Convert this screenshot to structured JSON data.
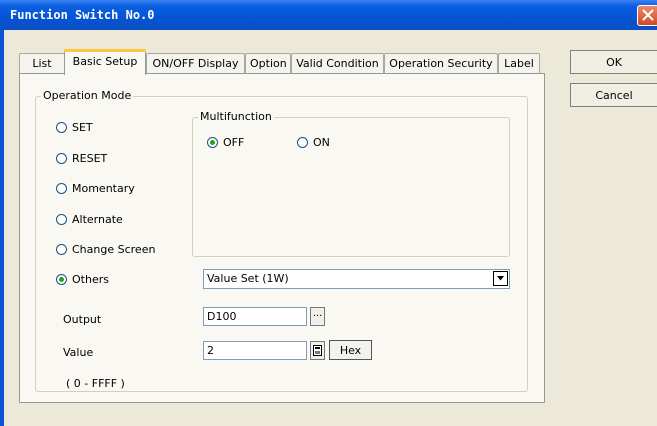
{
  "window": {
    "title": "Function Switch No.0"
  },
  "tabs": [
    {
      "label": "List"
    },
    {
      "label": "Basic Setup"
    },
    {
      "label": "ON/OFF Display"
    },
    {
      "label": "Option"
    },
    {
      "label": "Valid Condition"
    },
    {
      "label": "Operation Security"
    },
    {
      "label": "Label"
    }
  ],
  "active_tab": "Basic Setup",
  "operation_mode": {
    "title": "Operation Mode",
    "options": [
      "SET",
      "RESET",
      "Momentary",
      "Alternate",
      "Change Screen",
      "Others"
    ],
    "selected": "Others"
  },
  "multifunction": {
    "title": "Multifunction",
    "off_label": "OFF",
    "on_label": "ON",
    "selected": "OFF"
  },
  "others_select": {
    "value": "Value Set (1W)"
  },
  "output": {
    "label": "Output",
    "value": "D100",
    "browse_label": "..."
  },
  "value_field": {
    "label": "Value",
    "value": "2",
    "hex_label": "Hex"
  },
  "range_text": "( 0 - FFFF )",
  "buttons": {
    "ok": "OK",
    "cancel": "Cancel"
  },
  "colors": {
    "titlebar": "#0554d5",
    "close": "#cf4b22",
    "active_tab_highlight": "#ffc83c",
    "radio_checked": "#21a121"
  }
}
